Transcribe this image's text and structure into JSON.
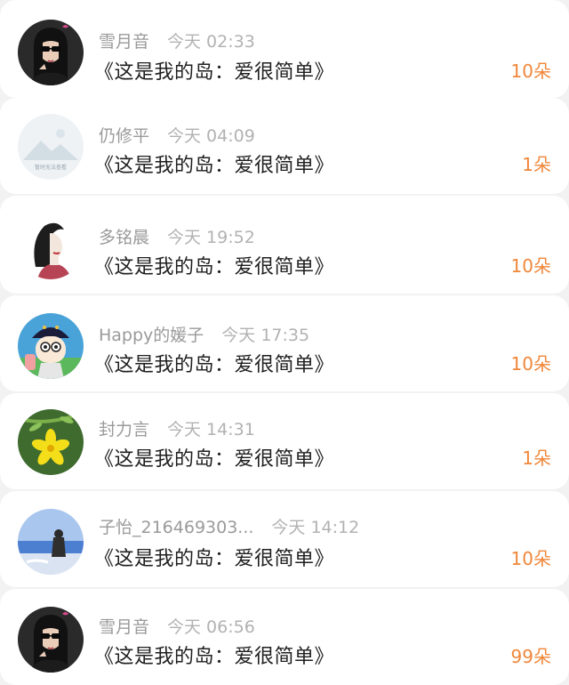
{
  "accent_color": "#f0873a",
  "items": [
    {
      "name": "雪月音",
      "time": "今天 02:33",
      "title": "《这是我的岛：爱很简单》",
      "count": "10朵",
      "avatar": "girl-sunglasses-avatar"
    },
    {
      "name": "仍修平",
      "time": "今天 04:09",
      "title": "《这是我的岛：爱很简单》",
      "count": "1朵",
      "avatar": "placeholder-mountain-avatar",
      "avatar_text": "暂时无法查看"
    },
    {
      "name": "多铭晨",
      "time": "今天 19:52",
      "title": "《这是我的岛：爱很简单》",
      "count": "10朵",
      "avatar": "illustrated-woman-avatar"
    },
    {
      "name": "Happy的媛子",
      "time": "今天 17:35",
      "title": "《这是我的岛：爱很简单》",
      "count": "10朵",
      "avatar": "cartoon-character-avatar"
    },
    {
      "name": "封力言",
      "time": "今天 14:31",
      "title": "《这是我的岛：爱很简单》",
      "count": "1朵",
      "avatar": "yellow-flower-avatar"
    },
    {
      "name": "子怡_216469303...",
      "time": "今天 14:12",
      "title": "《这是我的岛：爱很简单》",
      "count": "10朵",
      "avatar": "seaside-person-avatar"
    },
    {
      "name": "雪月音",
      "time": "今天 06:56",
      "title": "《这是我的岛：爱很简单》",
      "count": "99朵",
      "avatar": "girl-sunglasses-avatar"
    }
  ]
}
